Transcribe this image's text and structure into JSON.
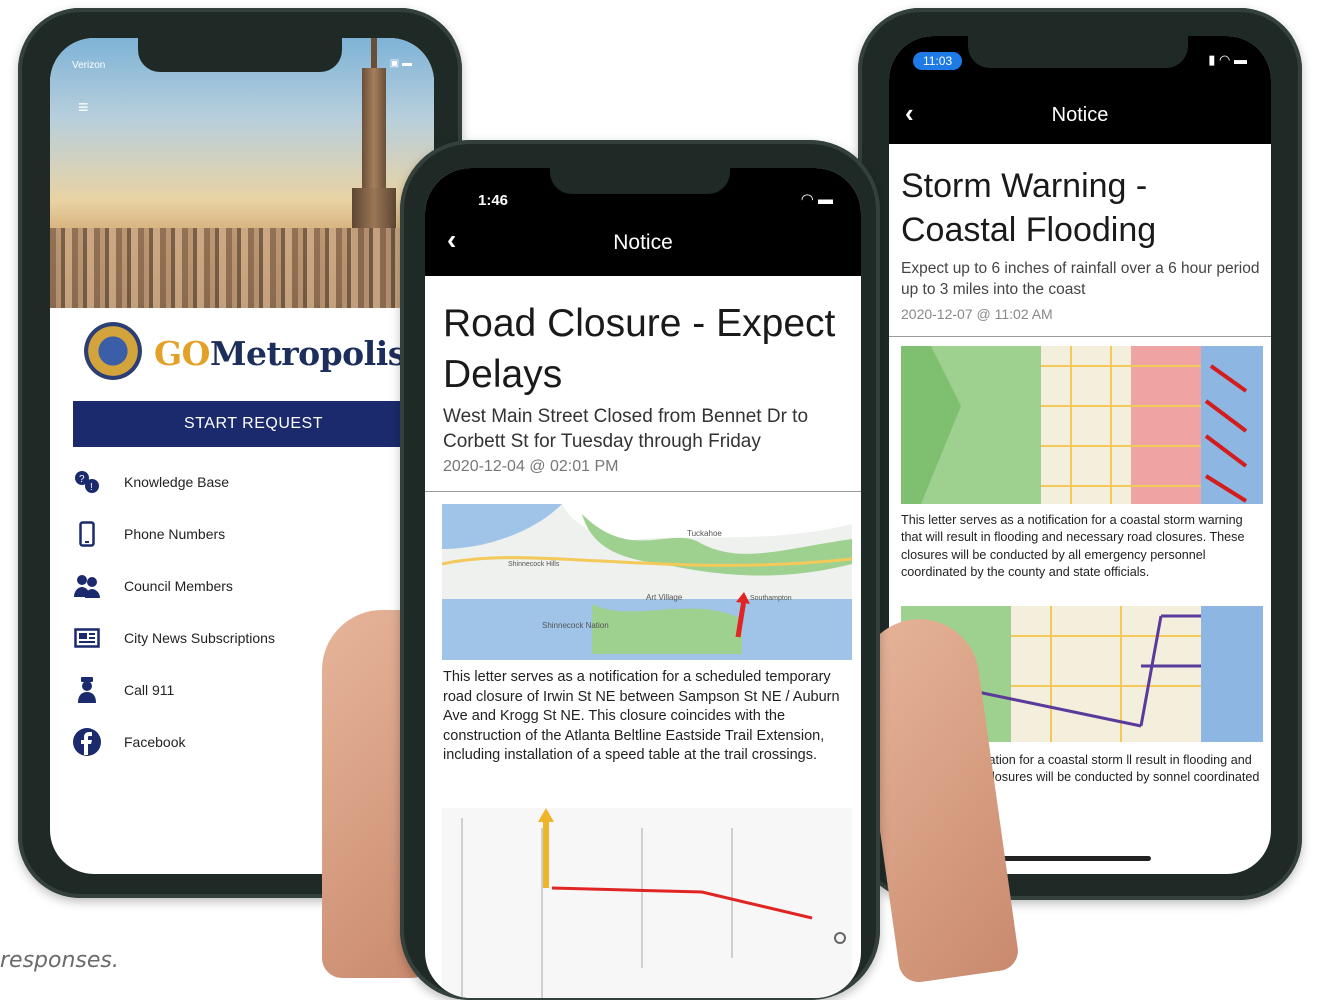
{
  "left_phone": {
    "status": {
      "carrier": "Verizon"
    },
    "brand": {
      "prefix": "GO",
      "suffix": "Metropolis"
    },
    "start_button": "START REQUEST",
    "menu": [
      {
        "label": "Knowledge Base",
        "icon": "knowledge-base-icon"
      },
      {
        "label": "Phone Numbers",
        "icon": "phone-icon"
      },
      {
        "label": "Council Members",
        "icon": "council-members-icon"
      },
      {
        "label": "City News Subscriptions",
        "icon": "news-icon"
      },
      {
        "label": "Call 911",
        "icon": "police-icon"
      },
      {
        "label": "Facebook",
        "icon": "facebook-icon"
      }
    ]
  },
  "middle_phone": {
    "time": "1:46",
    "nav_title": "Notice",
    "title": "Road Closure - Expect Delays",
    "subtitle": "West Main Street Closed from Bennet Dr to Corbett St for Tuesday through Friday",
    "date": "2020-12-04 @ 02:01 PM",
    "map_labels": [
      "Tuckahoe",
      "Shinnecock Hills",
      "Art Village",
      "Southampton",
      "Shinnecock Nation"
    ],
    "body": "This letter serves as a notification for a scheduled temporary road closure of Irwin St NE between Sampson St NE / Auburn Ave and Krogg St NE. This closure coincides with the construction of the Atlanta Beltline Eastside Trail Extension, including installation of a speed table at the trail crossings."
  },
  "right_phone": {
    "time": "11:03",
    "nav_title": "Notice",
    "title": "Storm Warning - Coastal Flooding",
    "subtitle": "Expect up to 6 inches of rainfall over a 6 hour period up to 3 miles into the coast",
    "date": "2020-12-07 @ 11:02 AM",
    "body": "This letter serves as a notification for a coastal storm warning that will result in flooding and necessary road closures. These closures will be conducted by all emergency personnel coordinated by the county and state officials.",
    "body_partial": "rves as a notification for a coastal storm ll result in flooding and necessary ese closures will be conducted by sonnel coordinated by the county"
  },
  "caption": "responses.",
  "colors": {
    "brand_navy": "#1a2a6c",
    "brand_gold": "#e3a227",
    "ios_blue": "#1e7ae6"
  }
}
